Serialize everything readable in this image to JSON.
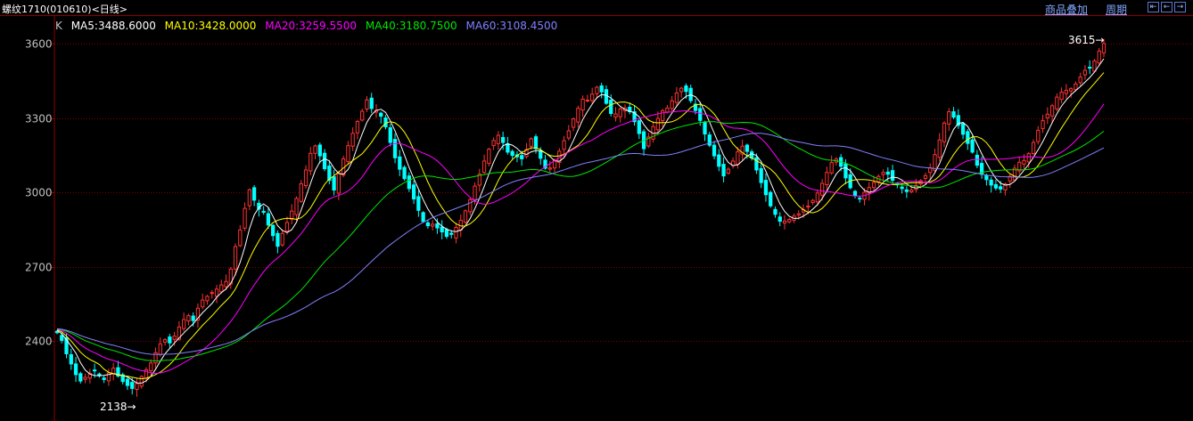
{
  "header": {
    "instrument_title": "螺纹1710(010610)",
    "period_tag": "<日线>",
    "overlay_link": "商品叠加",
    "period_link": "周期",
    "nav_icons": [
      "arrow-left-icon",
      "arrow-left-small-icon",
      "arrow-right-small-icon",
      "arrow-right-icon"
    ]
  },
  "legend": {
    "k_label": "K",
    "items": [
      {
        "text": "MA5:3488.6000",
        "color": "#ffffff"
      },
      {
        "text": "MA10:3428.0000",
        "color": "#ffff00"
      },
      {
        "text": "MA20:3259.5500",
        "color": "#ff00ff"
      },
      {
        "text": "MA40:3180.7500",
        "color": "#00e600"
      },
      {
        "text": "MA60:3108.4500",
        "color": "#8080ff"
      }
    ]
  },
  "colors": {
    "up": "#ff3232",
    "down": "#00ffff",
    "grid": "#7a0000",
    "axis": "#8b0000",
    "ma5": "#ffffff",
    "ma10": "#ffff00",
    "ma20": "#ff00ff",
    "ma40": "#00e600",
    "ma60": "#8080ff"
  },
  "chart_data": {
    "type": "candlestick",
    "y_ticks": [
      "3600",
      "3300",
      "3000",
      "2700",
      "2400"
    ],
    "ylim": [
      2100,
      3700
    ],
    "annotations": {
      "high": "3615",
      "low": "2138"
    },
    "closes": [
      2433,
      2402,
      2348,
      2307,
      2264,
      2238,
      2253,
      2268,
      2279,
      2259,
      2244,
      2271,
      2290,
      2258,
      2236,
      2220,
      2208,
      2228,
      2256,
      2283,
      2311,
      2352,
      2388,
      2405,
      2392,
      2419,
      2456,
      2486,
      2502,
      2482,
      2532,
      2565,
      2580,
      2595,
      2609,
      2626,
      2640,
      2690,
      2781,
      2848,
      2935,
      3010,
      2968,
      2932,
      2919,
      2868,
      2825,
      2782,
      2834,
      2878,
      2924,
      2975,
      3034,
      3090,
      3157,
      3187,
      3147,
      3095,
      3048,
      3009,
      3078,
      3135,
      3188,
      3238,
      3286,
      3327,
      3373,
      3338,
      3330,
      3307,
      3264,
      3201,
      3139,
      3093,
      3055,
      3015,
      2973,
      2927,
      2882,
      2865,
      2871,
      2856,
      2840,
      2822,
      2830,
      2858,
      2887,
      2925,
      2970,
      3025,
      3073,
      3126,
      3174,
      3209,
      3230,
      3201,
      3162,
      3149,
      3143,
      3135,
      3173,
      3216,
      3176,
      3137,
      3097,
      3098,
      3128,
      3166,
      3208,
      3248,
      3296,
      3339,
      3376,
      3372,
      3396,
      3424,
      3405,
      3359,
      3318,
      3316,
      3336,
      3340,
      3325,
      3285,
      3237,
      3176,
      3223,
      3265,
      3298,
      3329,
      3340,
      3369,
      3401,
      3420,
      3407,
      3370,
      3330,
      3290,
      3235,
      3190,
      3147,
      3105,
      3066,
      3093,
      3126,
      3163,
      3186,
      3165,
      3138,
      3090,
      3039,
      2990,
      2945,
      2911,
      2883,
      2884,
      2890,
      2904,
      2913,
      2930,
      2944,
      2967,
      2997,
      3036,
      3080,
      3120,
      3134,
      3105,
      3058,
      3018,
      2987,
      2976,
      3000,
      3019,
      3039,
      3064,
      3080,
      3073,
      3048,
      3030,
      3015,
      3003,
      3009,
      3028,
      3047,
      3067,
      3099,
      3152,
      3211,
      3279,
      3325,
      3303,
      3270,
      3234,
      3197,
      3162,
      3109,
      3072,
      3051,
      3029,
      3017,
      3013,
      3033,
      3064,
      3097,
      3121,
      3128,
      3156,
      3201,
      3250,
      3289,
      3315,
      3349,
      3384,
      3404,
      3411,
      3418,
      3437,
      3465,
      3492,
      3503,
      3530,
      3570,
      3600
    ]
  }
}
